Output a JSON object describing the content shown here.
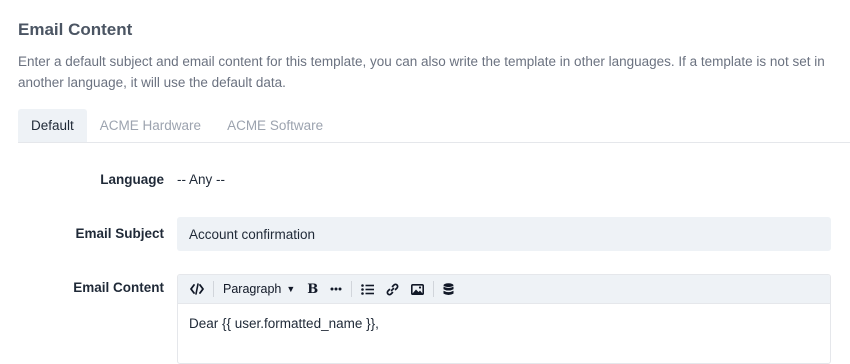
{
  "section": {
    "title": "Email Content",
    "description": "Enter a default subject and email content for this template, you can also write the template in other languages. If a template is not set in another language, it will use the default data."
  },
  "tabs": [
    {
      "label": "Default",
      "active": true
    },
    {
      "label": "ACME Hardware",
      "active": false
    },
    {
      "label": "ACME Software",
      "active": false
    }
  ],
  "form": {
    "language_label": "Language",
    "language_value": "-- Any --",
    "subject_label": "Email Subject",
    "subject_value": "Account confirmation",
    "content_label": "Email Content"
  },
  "editor": {
    "toolbar": {
      "code_icon": "code-icon",
      "format_label": "Paragraph",
      "bold_label": "B",
      "more_icon": "more-icon",
      "list_icon": "list-icon",
      "link_icon": "link-icon",
      "image_icon": "image-icon",
      "database_icon": "database-icon"
    },
    "content": "Dear {{ user.formatted_name }},"
  },
  "colors": {
    "accent_bg": "#eef2f6",
    "heading": "#4b5563",
    "muted": "#6b7280",
    "inactive_tab": "#9ca3af"
  }
}
